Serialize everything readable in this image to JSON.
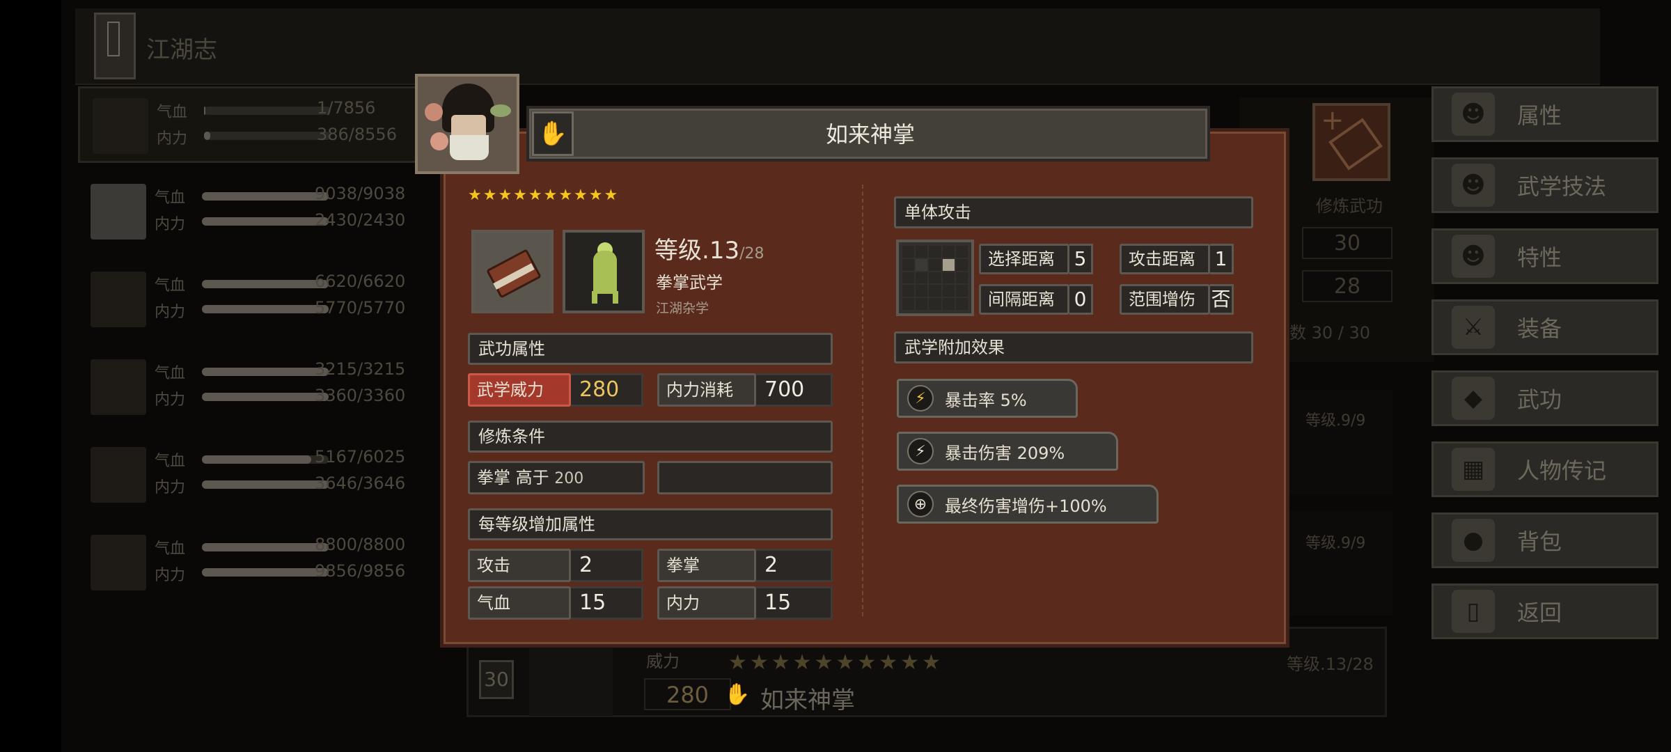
{
  "header": {
    "title": "江湖志"
  },
  "party": [
    {
      "hp_label": "气血",
      "mp_label": "内力",
      "hp": "1/7856",
      "mp": "386/8556",
      "hp_fill": 0.01,
      "mp_fill": 0.05
    },
    {
      "hp_label": "气血",
      "mp_label": "内力",
      "hp": "9038/9038",
      "mp": "2430/2430",
      "hp_fill": 1.0,
      "mp_fill": 1.0
    },
    {
      "hp_label": "气血",
      "mp_label": "内力",
      "hp": "6620/6620",
      "mp": "5770/5770",
      "hp_fill": 1.0,
      "mp_fill": 1.0
    },
    {
      "hp_label": "气血",
      "mp_label": "内力",
      "hp": "3215/3215",
      "mp": "3360/3360",
      "hp_fill": 1.0,
      "mp_fill": 1.0
    },
    {
      "hp_label": "气血",
      "mp_label": "内力",
      "hp": "5167/6025",
      "mp": "3646/3646",
      "hp_fill": 0.86,
      "mp_fill": 1.0
    },
    {
      "hp_label": "气血",
      "mp_label": "内力",
      "hp": "8800/8800",
      "mp": "9856/9856",
      "hp_fill": 1.0,
      "mp_fill": 1.0
    }
  ],
  "side_info": {
    "practice_label": "修炼武功",
    "values": [
      "30",
      "28"
    ],
    "count": "数  30 / 30",
    "levels": [
      "等级.9/9",
      "等级.9/9"
    ]
  },
  "bottom_card": {
    "badge": "30",
    "power_label": "威力",
    "power_value": "280",
    "stars": "★★★★★★★★★★",
    "name": "如来神掌",
    "level": "等级.13/28"
  },
  "nav": [
    {
      "label": "属性",
      "icon": "person-icon"
    },
    {
      "label": "武学技法",
      "icon": "skill-person-icon"
    },
    {
      "label": "特性",
      "icon": "trait-icon"
    },
    {
      "label": "装备",
      "icon": "sword-icon"
    },
    {
      "label": "武功",
      "icon": "martial-book-icon"
    },
    {
      "label": "人物传记",
      "icon": "biography-icon"
    },
    {
      "label": "背包",
      "icon": "bag-icon"
    },
    {
      "label": "返回",
      "icon": "door-icon"
    }
  ],
  "dialog": {
    "title": "如来神掌",
    "stars": "★★★★★★★★★★",
    "level_prefix": "等级.",
    "level": "13",
    "level_max": "/28",
    "type": "拳掌武学",
    "school": "江湖杂学",
    "attr_header": "武功属性",
    "power_label": "武学威力",
    "power_value": "280",
    "mp_cost_label": "内力消耗",
    "mp_cost_value": "700",
    "cond_header": "修炼条件",
    "cond_text": "拳掌 高于",
    "cond_value": "200",
    "growth_header": "每等级增加属性",
    "growth": [
      {
        "label": "攻击",
        "value": "2"
      },
      {
        "label": "拳掌",
        "value": "2"
      },
      {
        "label": "气血",
        "value": "15"
      },
      {
        "label": "内力",
        "value": "15"
      }
    ],
    "target_header": "单体攻击",
    "select_range_label": "选择距离",
    "select_range_value": "5",
    "attack_range_label": "攻击距离",
    "attack_range_value": "1",
    "gap_range_label": "间隔距离",
    "gap_range_value": "0",
    "aoe_bonus_label": "范围增伤",
    "aoe_bonus_value": "否",
    "effects_header": "武学附加效果",
    "effects": [
      {
        "text": "暴击率 5%",
        "icon": "lightning-icon"
      },
      {
        "text": "暴击伤害 209%",
        "icon": "lightning-icon"
      },
      {
        "text": "最终伤害增伤+100%",
        "icon": "target-icon"
      }
    ]
  }
}
